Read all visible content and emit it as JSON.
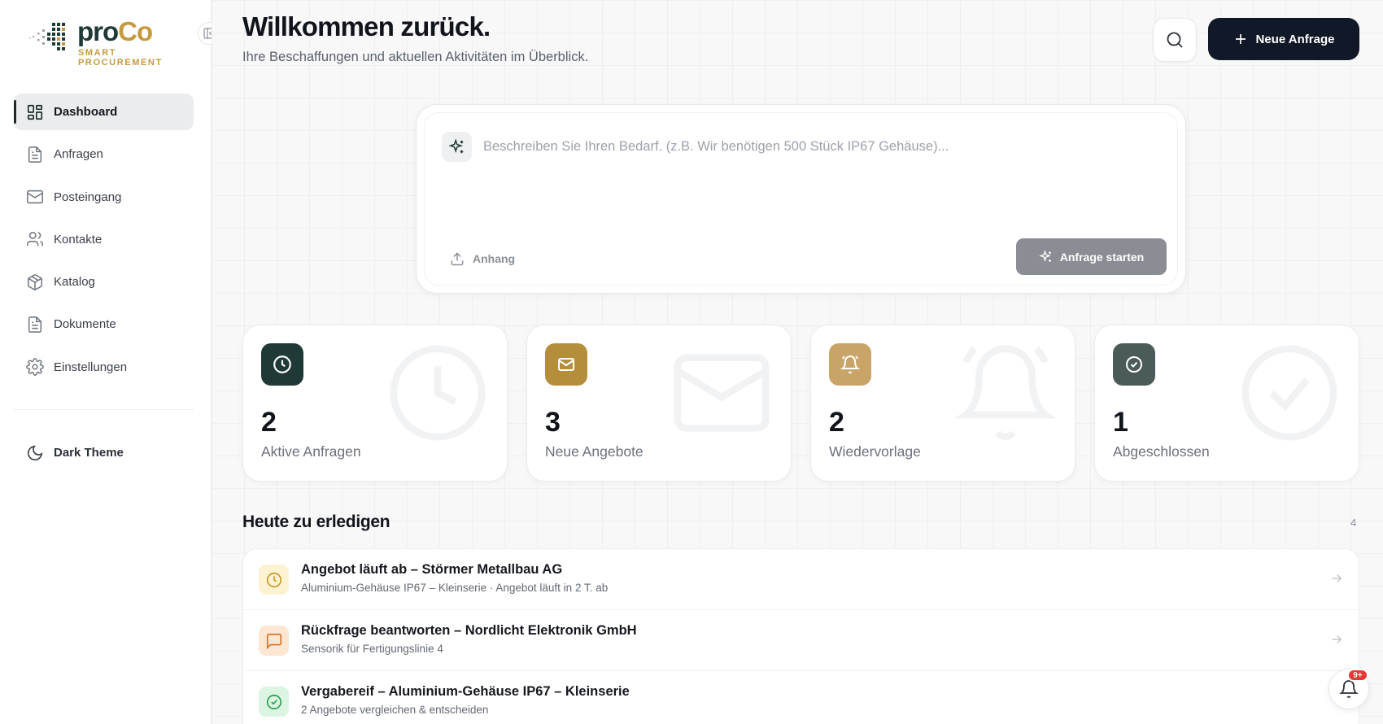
{
  "brand": {
    "name_part1": "pro",
    "name_part2": "Co",
    "tagline": "SMART PROCUREMENT"
  },
  "sidebar": {
    "items": [
      {
        "label": "Dashboard",
        "icon": "dashboard-icon",
        "active": true
      },
      {
        "label": "Anfragen",
        "icon": "file-icon"
      },
      {
        "label": "Posteingang",
        "icon": "mail-icon"
      },
      {
        "label": "Kontakte",
        "icon": "users-icon"
      },
      {
        "label": "Katalog",
        "icon": "package-icon"
      },
      {
        "label": "Dokumente",
        "icon": "document-icon"
      },
      {
        "label": "Einstellungen",
        "icon": "gear-icon"
      }
    ],
    "theme_label": "Dark Theme"
  },
  "header": {
    "title": "Willkommen zurück.",
    "subtitle": "Ihre Beschaffungen und aktuellen Aktivitäten im Überblick.",
    "new_button": "Neue Anfrage"
  },
  "request": {
    "placeholder": "Beschreiben Sie Ihren Bedarf. (z.B. Wir benötigen 500 Stück IP67 Gehäuse)...",
    "attach_label": "Anhang",
    "start_label": "Anfrage starten"
  },
  "stats": [
    {
      "value": "2",
      "label": "Aktive Anfragen",
      "icon": "clock-icon",
      "color": "#1f3a36"
    },
    {
      "value": "3",
      "label": "Neue Angebote",
      "icon": "mail-icon",
      "color": "#b58e3c"
    },
    {
      "value": "2",
      "label": "Wiedervorlage",
      "icon": "bell-icon",
      "color": "#c9a468"
    },
    {
      "value": "1",
      "label": "Abgeschlossen",
      "icon": "check-circle-icon",
      "color": "#4b5b59"
    }
  ],
  "todo": {
    "title": "Heute zu erledigen",
    "count": "4",
    "items": [
      {
        "title": "Angebot läuft ab – Störmer Metallbau AG",
        "subtitle": "Aluminium-Gehäuse IP67 – Kleinserie · Angebot läuft in 2 T. ab",
        "icon": "clock-icon"
      },
      {
        "title": "Rückfrage beantworten – Nordlicht Elektronik GmbH",
        "subtitle": "Sensorik für Fertigungslinie 4",
        "icon": "message-icon"
      },
      {
        "title": "Vergabereif – Aluminium-Gehäuse IP67 – Kleinserie",
        "subtitle": "2 Angebote vergleichen & entscheiden",
        "icon": "check-circle-icon"
      }
    ]
  },
  "notifications": {
    "badge": "9+"
  },
  "colors": {
    "accent_dark": "#111827",
    "brand_green": "#1e3a36",
    "brand_gold": "#c59a3e"
  }
}
